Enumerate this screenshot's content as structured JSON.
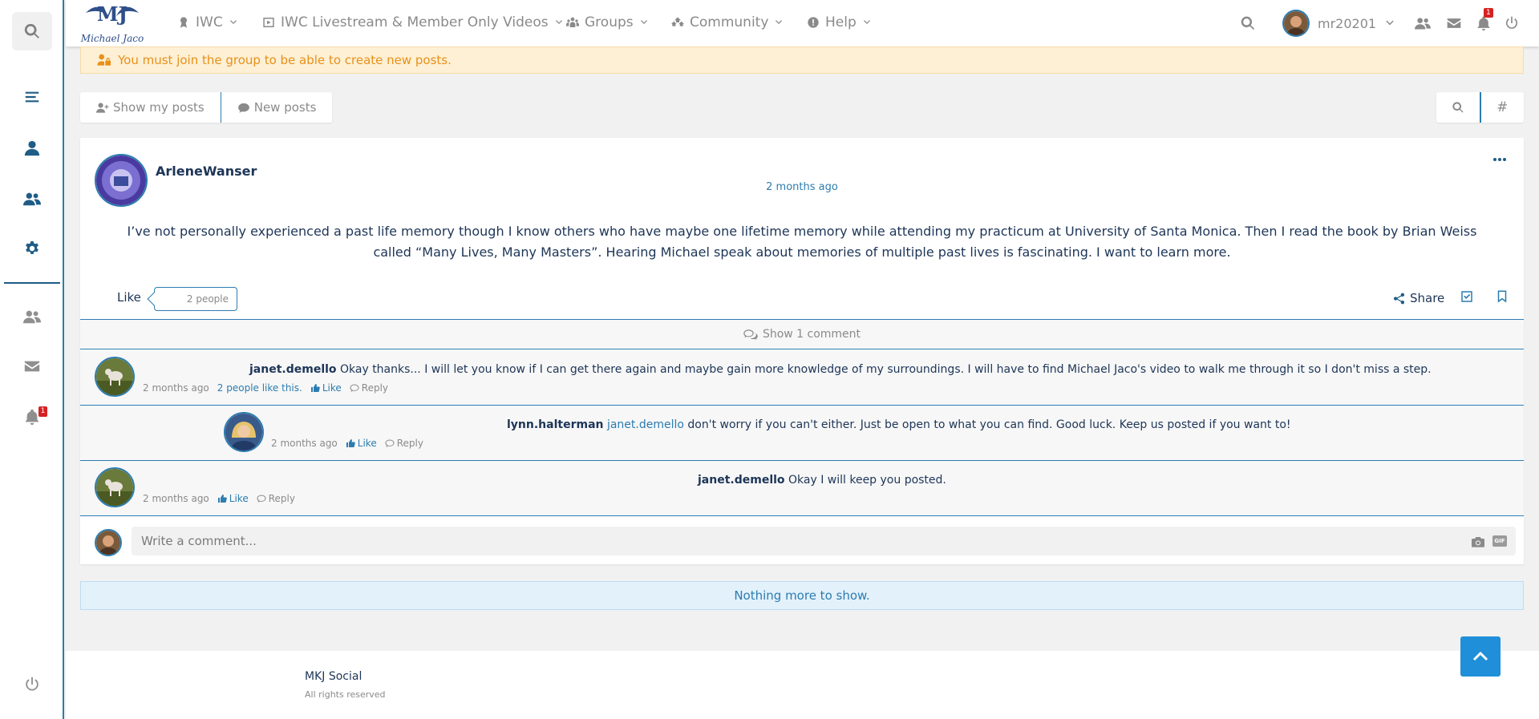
{
  "nav": {
    "items": [
      {
        "label": "IWC",
        "icon": "medal-icon"
      },
      {
        "label": "IWC Livestream & Member Only Videos",
        "icon": "video-icon"
      },
      {
        "label": "Groups",
        "icon": "groups-icon"
      },
      {
        "label": "Community",
        "icon": "community-icon"
      },
      {
        "label": "Help",
        "icon": "info-icon"
      }
    ],
    "username": "mr20201",
    "notification_count": "1"
  },
  "logo": {
    "initials": "MJ",
    "script_text": "Michael Jaco"
  },
  "sidebar": {
    "notification_count": "1"
  },
  "warning": "You must join the group to be able to create new posts.",
  "tabs": {
    "show_my_posts": "Show my posts",
    "new_posts": "New posts"
  },
  "tools": {
    "hash": "#"
  },
  "post": {
    "author": "ArleneWanser",
    "time": "2 months ago",
    "body": "I’ve not personally experienced a past life memory though I know others who have maybe one lifetime memory while attending my practicum at University of Santa Monica. Then I read the book by Brian Weiss called “Many Lives, Many Masters”. Hearing Michael speak about memories of multiple past lives is fascinating. I want to learn more.",
    "like_label": "Like",
    "like_count": "2 people",
    "share_label": "Share",
    "show_comments": "Show 1 comment"
  },
  "comments": [
    {
      "author": "janet.demello",
      "mention": "",
      "text": "Okay thanks... I will let you know if I can get there again and maybe gain more knowledge of my surroundings. I will have to find Michael Jaco's video to walk me through it so I don't miss a step.",
      "time": "2 months ago",
      "likes": "2 people like this.",
      "like": "Like",
      "reply": "Reply"
    },
    {
      "author": "lynn.halterman",
      "mention": "janet.demello",
      "text": "don't worry if you can't either. Just be open to what you can find. Good luck. Keep us posted if you want to!",
      "time": "2 months ago",
      "likes": "",
      "like": "Like",
      "reply": "Reply"
    },
    {
      "author": "janet.demello",
      "mention": "",
      "text": "Okay I will keep you posted.",
      "time": "2 months ago",
      "likes": "",
      "like": "Like",
      "reply": "Reply"
    }
  ],
  "write": {
    "placeholder": "Write a comment...",
    "gif": "GIF"
  },
  "nothing_more": "Nothing more to show.",
  "footer": {
    "title": "MKJ Social",
    "subtitle": "All rights reserved"
  },
  "colors": {
    "accent": "#2c7cb0",
    "navy": "#1d3557",
    "warning_text": "#e8901a",
    "badge": "#d62222"
  }
}
